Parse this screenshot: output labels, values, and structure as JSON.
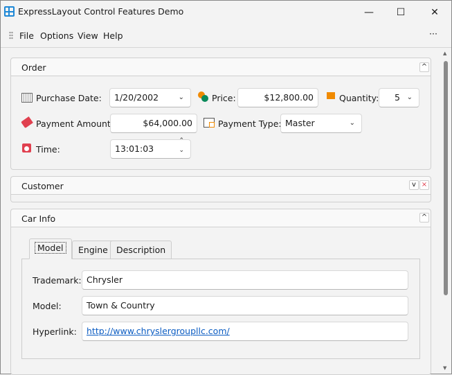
{
  "window": {
    "title": "ExpressLayout Control Features Demo",
    "minimize": "—",
    "maximize": "☐",
    "close": "✕"
  },
  "menu": {
    "items": [
      "File",
      "Options",
      "View",
      "Help"
    ],
    "more": "···"
  },
  "order": {
    "title": "Order",
    "collapse": "^",
    "purchase_date_label": "Purchase Date:",
    "purchase_date": "1/20/2002",
    "price_label": "Price:",
    "price": "$12,800.00",
    "quantity_label": "Quantity:",
    "quantity": "5",
    "payment_amount_label": "Payment Amount:",
    "payment_amount": "$64,000.00",
    "payment_type_label": "Payment Type:",
    "payment_type": "Master",
    "time_label": "Time:",
    "time": "13:01:03"
  },
  "customer": {
    "title": "Customer",
    "expand": "v",
    "close": "×"
  },
  "car_info": {
    "title": "Car Info",
    "collapse": "^",
    "tabs": [
      "Model",
      "Engine",
      "Description"
    ],
    "trademark_label": "Trademark:",
    "trademark": "Chrysler",
    "model_label": "Model:",
    "model": "Town & Country",
    "hyperlink_label": "Hyperlink:",
    "hyperlink": "http://www.chryslergroupllc.com/"
  },
  "scrollbar": {
    "up": "▲",
    "down": "▼"
  }
}
